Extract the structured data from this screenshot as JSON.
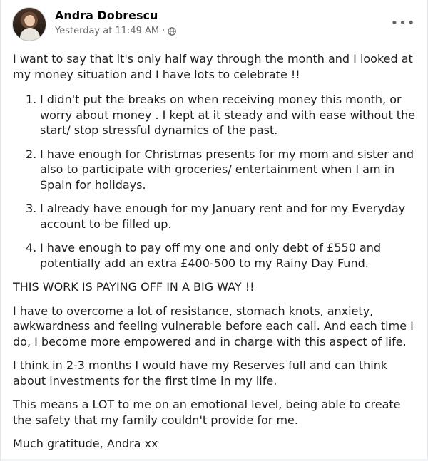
{
  "post": {
    "author": "Andra Dobrescu",
    "timestamp": "Yesterday at 11:49 AM",
    "separator": "·",
    "audience_icon": "globe-icon",
    "more_label": "•••",
    "intro": "I want to say that it's only half way through the month and I looked at my money situation and I have lots to celebrate !!",
    "list": [
      {
        "num": "1.",
        "text": "I didn't put the breaks on when receiving money this month, or worry about money . I kept at it steady and with ease without the start/ stop stressful dynamics of the past."
      },
      {
        "num": "2.",
        "text": "I have enough for Christmas presents for my mom and sister and also to participate with groceries/ entertainment when I am in Spain for holidays."
      },
      {
        "num": "3.",
        "text": "I already have enough for my January rent and for my Everyday account to be filled up."
      },
      {
        "num": "4.",
        "text": "I have enough to pay off my one and only debt of £550 and potentially add an extra £400-500 to my Rainy Day Fund."
      }
    ],
    "shout": "THIS WORK IS PAYING OFF IN A BIG WAY !!",
    "paragraph_1": "I have to overcome a lot of resistance, stomach knots, anxiety, awkwardness and feeling vulnerable before each call. And each time I do, I become more empowered and in charge with this aspect of life.",
    "paragraph_2": "I think in 2-3 months I would have my Reserves full and can think about investments for the first time in my life.",
    "paragraph_3": "This means a LOT to me on an emotional level, being able to create the safety that my family couldn't provide for me.",
    "signoff": "Much gratitude, Andra xx"
  },
  "colors": {
    "text": "#1c1e21",
    "meta": "#65676b",
    "name": "#050505"
  }
}
